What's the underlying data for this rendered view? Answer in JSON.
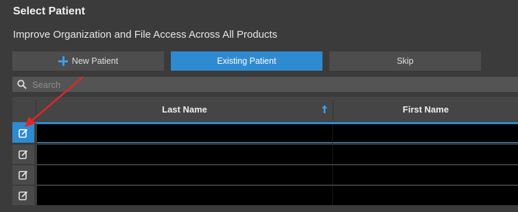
{
  "window": {
    "title": "Select Patient",
    "subtitle": "Improve Organization and File Access Across All Products"
  },
  "tabs": {
    "new_patient": "New Patient",
    "existing_patient": "Existing Patient",
    "skip": "Skip"
  },
  "search": {
    "placeholder": "Search"
  },
  "table": {
    "columns": [
      "Last Name",
      "First Name"
    ],
    "sort": {
      "column": "Last Name",
      "direction": "ascending"
    },
    "rows": [
      {
        "selected": true
      },
      {
        "selected": false
      },
      {
        "selected": false
      },
      {
        "selected": false
      }
    ]
  },
  "annotation": {
    "arrow_color": "#e0262a"
  },
  "colors": {
    "accent": "#2f8bd1",
    "background": "#3b3b3b"
  }
}
